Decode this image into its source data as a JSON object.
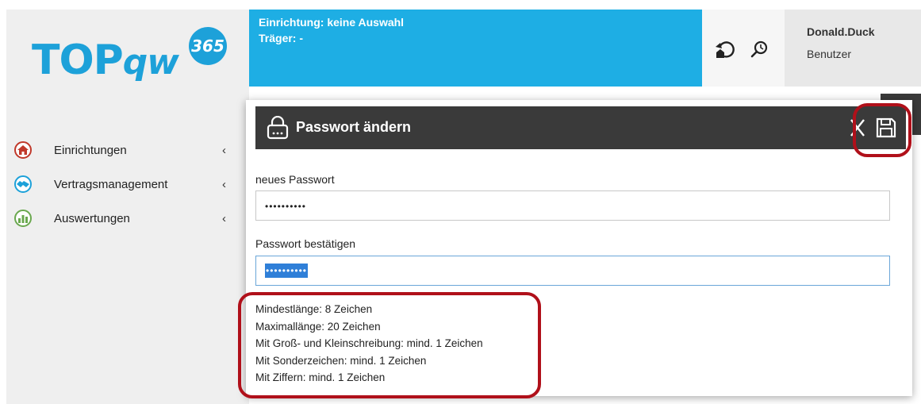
{
  "logo": {
    "text_main": "TOP",
    "text_sub": "qw",
    "badge": "365"
  },
  "nav": {
    "items": [
      {
        "label": "Einrichtungen",
        "icon": "home-icon",
        "color": "#c0392b"
      },
      {
        "label": "Vertragsmanagement",
        "icon": "handshake-icon",
        "color": "#1da1d9"
      },
      {
        "label": "Auswertungen",
        "icon": "bar-chart-icon",
        "color": "#6aa84f"
      }
    ],
    "chevron": "‹"
  },
  "header": {
    "einrichtung": "Einrichtung: keine Auswahl",
    "traeger": "Träger: -"
  },
  "user": {
    "name": "Donald.Duck",
    "role": "Benutzer"
  },
  "dialog": {
    "title": "Passwort ändern",
    "new_password_label": "neues Passwort",
    "new_password_value": "••••••••••",
    "confirm_label": "Passwort bestätigen",
    "confirm_value": "••••••••••",
    "rules": [
      "Mindestlänge: 8 Zeichen",
      "Maximallänge: 20 Zeichen",
      "Mit Groß- und Kleinschreibung: mind. 1 Zeichen",
      "Mit Sonderzeichen: mind. 1 Zeichen",
      "Mit Ziffern: mind. 1 Zeichen"
    ]
  },
  "colors": {
    "brand": "#1da1d9",
    "header_bg": "#1eaee4",
    "dialog_header": "#3a3a3a",
    "highlight": "#b0101a"
  }
}
